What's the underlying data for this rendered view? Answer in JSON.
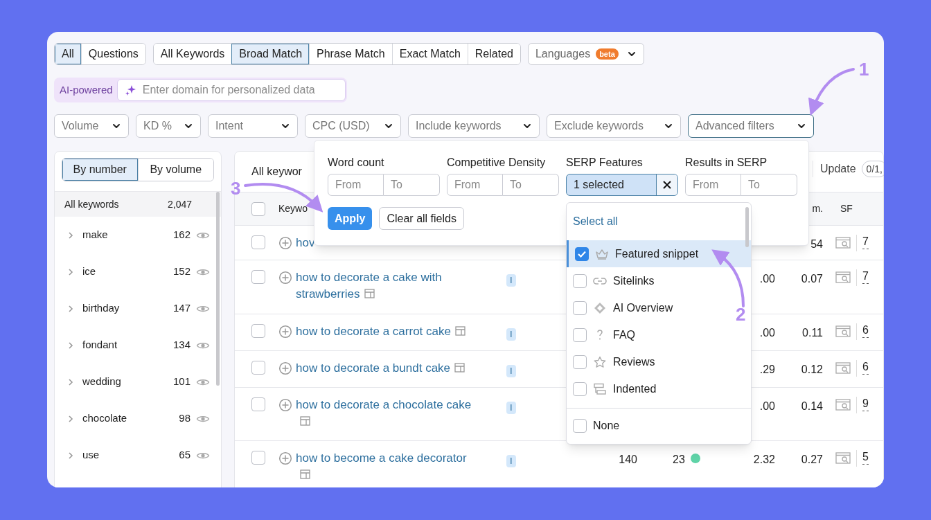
{
  "type_tabs": [
    {
      "label": "All",
      "selected": true
    },
    {
      "label": "Questions",
      "selected": false
    }
  ],
  "match_tabs": [
    {
      "label": "All Keywords",
      "selected": false
    },
    {
      "label": "Broad Match",
      "selected": true
    },
    {
      "label": "Phrase Match",
      "selected": false
    },
    {
      "label": "Exact Match",
      "selected": false
    },
    {
      "label": "Related",
      "selected": false
    }
  ],
  "languages": {
    "label": "Languages",
    "badge": "beta"
  },
  "ai_domain": {
    "label": "AI-powered",
    "placeholder": "Enter domain for personalized data"
  },
  "filters": [
    {
      "label": "Volume",
      "open": false
    },
    {
      "label": "KD %",
      "open": false
    },
    {
      "label": "Intent",
      "open": false
    },
    {
      "label": "CPC (USD)",
      "open": false
    },
    {
      "label": "Include keywords",
      "open": false
    },
    {
      "label": "Exclude keywords",
      "open": false
    },
    {
      "label": "Advanced filters",
      "open": true
    }
  ],
  "sidebar": {
    "toggle": [
      {
        "label": "By number",
        "selected": true
      },
      {
        "label": "By volume",
        "selected": false
      }
    ],
    "total": {
      "label": "All keywords",
      "count": "2,047"
    },
    "groups": [
      {
        "label": "make",
        "count": "162"
      },
      {
        "label": "ice",
        "count": "152"
      },
      {
        "label": "birthday",
        "count": "147"
      },
      {
        "label": "fondant",
        "count": "134"
      },
      {
        "label": "wedding",
        "count": "101"
      },
      {
        "label": "chocolate",
        "count": "98"
      },
      {
        "label": "use",
        "count": "65"
      }
    ]
  },
  "table": {
    "title": "All keywor",
    "update": "Update",
    "counter": "0/1,",
    "columns": {
      "keyword": "Keywo",
      "com": "m.",
      "sf": "SF"
    },
    "all_checked": false,
    "rows": [
      {
        "checked": false,
        "keyword": "hov",
        "serp_icon": false,
        "com": "54",
        "sf": "7"
      },
      {
        "checked": false,
        "keyword": "how to decorate a cake with strawberries",
        "serp_icon": true,
        "intent": "I",
        "cpc": ".00",
        "com": "0.07",
        "sf": "7"
      },
      {
        "checked": false,
        "keyword": "how to decorate a carrot cake",
        "serp_icon": true,
        "intent": "I",
        "cpc": ".00",
        "com": "0.11",
        "sf": "6"
      },
      {
        "checked": false,
        "keyword": "how to decorate a bundt cake",
        "serp_icon": true,
        "intent": "I",
        "cpc": ".29",
        "com": "0.12",
        "sf": "6"
      },
      {
        "checked": false,
        "keyword": "how to decorate a chocolate cake",
        "serp_icon": true,
        "intent": "I",
        "cpc": ".00",
        "com": "0.14",
        "sf": "9"
      },
      {
        "checked": false,
        "keyword": "how to become a cake decorator",
        "serp_icon": true,
        "intent": "I",
        "volume": "140",
        "kd": "23",
        "color": "#5fd3a7",
        "cpc": "2.32",
        "com": "0.27",
        "sf": "5"
      }
    ]
  },
  "advanced_filters": {
    "fields": [
      {
        "label": "Word count",
        "kind": "range",
        "from": {
          "placeholder": "From"
        },
        "to": {
          "placeholder": "To"
        }
      },
      {
        "label": "Competitive Density",
        "kind": "range",
        "from": {
          "placeholder": "From"
        },
        "to": {
          "placeholder": "To"
        }
      },
      {
        "label": "SERP Features",
        "kind": "select",
        "value": "1 selected"
      },
      {
        "label": "Results in SERP",
        "kind": "range",
        "from": {
          "placeholder": "From"
        },
        "to": {
          "placeholder": "To"
        }
      }
    ],
    "apply": "Apply",
    "clear": "Clear all fields"
  },
  "serp_dropdown": {
    "select_all": "Select all",
    "options": [
      {
        "label": "Featured snippet",
        "checked": true
      },
      {
        "label": "Sitelinks",
        "checked": false
      },
      {
        "label": "AI Overview",
        "checked": false
      },
      {
        "label": "FAQ",
        "checked": false
      },
      {
        "label": "Reviews",
        "checked": false
      },
      {
        "label": "Indented",
        "checked": false
      }
    ],
    "none": {
      "label": "None",
      "checked": false
    }
  },
  "annotations": [
    {
      "number": "1"
    },
    {
      "number": "2"
    },
    {
      "number": "3"
    }
  ]
}
